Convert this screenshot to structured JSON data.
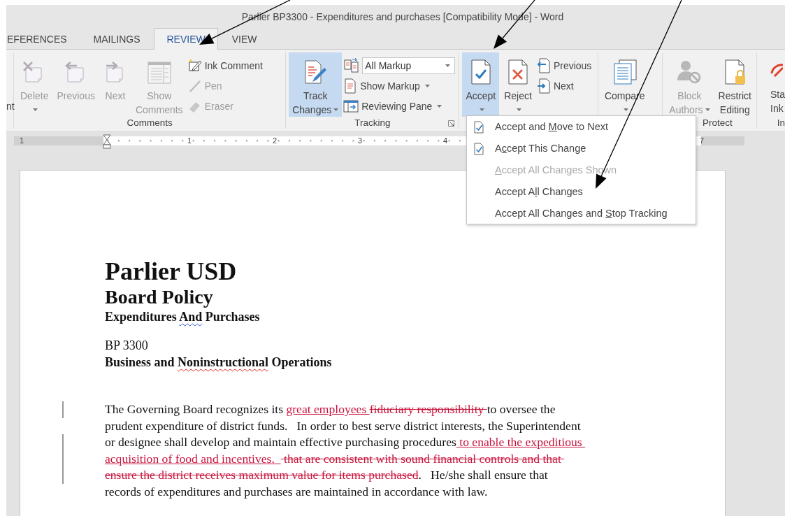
{
  "window": {
    "title": "Parlier BP3300 - Expenditures and purchases [Compatibility Mode] - Word"
  },
  "tabs": [
    {
      "label": "EFERENCES",
      "selected": false
    },
    {
      "label": "MAILINGS",
      "selected": false
    },
    {
      "label": "REVIEW",
      "selected": true
    },
    {
      "label": "VIEW",
      "selected": false
    }
  ],
  "ribbon": {
    "groups": [
      {
        "buttons": [
          {
            "kind": "fragment",
            "lines": [
              "nt"
            ],
            "disabled": false,
            "highlighted": false,
            "dropdown": false
          }
        ]
      },
      {
        "label": "Comments",
        "buttons": [
          {
            "kind": "large",
            "lines": [
              "Delete"
            ],
            "disabled": true,
            "highlighted": false,
            "dropdown": true
          },
          {
            "kind": "large",
            "lines": [
              "Previous"
            ],
            "disabled": true,
            "highlighted": false,
            "dropdown": false
          },
          {
            "kind": "large",
            "lines": [
              "Next"
            ],
            "disabled": true,
            "highlighted": false,
            "dropdown": false
          },
          {
            "kind": "large",
            "lines": [
              "Show",
              "Comments"
            ],
            "disabled": true,
            "highlighted": false,
            "dropdown": false
          },
          {
            "kind": "small",
            "lines": [
              "Ink Comment"
            ],
            "disabled": false,
            "highlighted": false,
            "dropdown": false
          },
          {
            "kind": "small",
            "lines": [
              "Pen"
            ],
            "disabled": true,
            "highlighted": false,
            "dropdown": false
          },
          {
            "kind": "small",
            "lines": [
              "Eraser"
            ],
            "disabled": true,
            "highlighted": false,
            "dropdown": false
          }
        ]
      },
      {
        "label": "Tracking",
        "launcher": true,
        "buttons": [
          {
            "kind": "large",
            "lines": [
              "Track",
              "Changes"
            ],
            "disabled": false,
            "highlighted": true,
            "dropdown": true
          },
          {
            "kind": "combo",
            "lines": [
              "All Markup"
            ],
            "disabled": false,
            "highlighted": false,
            "dropdown": true
          },
          {
            "kind": "small",
            "lines": [
              "Show Markup"
            ],
            "disabled": false,
            "highlighted": false,
            "dropdown": true
          },
          {
            "kind": "small",
            "lines": [
              "Reviewing Pane"
            ],
            "disabled": false,
            "highlighted": false,
            "dropdown": true
          }
        ]
      },
      {
        "buttons": [
          {
            "kind": "large",
            "lines": [
              "Accept"
            ],
            "disabled": false,
            "highlighted": true,
            "dropdown": true
          },
          {
            "kind": "large",
            "lines": [
              "Reject"
            ],
            "disabled": false,
            "highlighted": false,
            "dropdown": true
          },
          {
            "kind": "small",
            "lines": [
              "Previous"
            ],
            "disabled": false,
            "highlighted": false,
            "dropdown": false
          },
          {
            "kind": "small",
            "lines": [
              "Next"
            ],
            "disabled": false,
            "highlighted": false,
            "dropdown": false
          }
        ]
      },
      {
        "buttons": [
          {
            "kind": "large",
            "lines": [
              "Compare"
            ],
            "disabled": false,
            "highlighted": false,
            "dropdown": true
          }
        ]
      },
      {
        "label": "Protect",
        "buttons": [
          {
            "kind": "large",
            "lines": [
              "Block",
              "Authors"
            ],
            "disabled": true,
            "highlighted": false,
            "dropdown": true
          },
          {
            "kind": "large",
            "lines": [
              "Restrict",
              "Editing"
            ],
            "disabled": false,
            "highlighted": false,
            "dropdown": false
          }
        ]
      },
      {
        "label": "In",
        "buttons": [
          {
            "kind": "large",
            "lines": [
              "Sta",
              "Ink"
            ],
            "disabled": false,
            "highlighted": false,
            "dropdown": false
          }
        ]
      }
    ]
  },
  "ruler": {
    "numbers": [
      "1",
      "1",
      "2",
      "3",
      "4",
      "7"
    ]
  },
  "menu": {
    "items": [
      {
        "kind": "icon",
        "label": [
          {
            "text": "Accept and ",
            "access_key": false
          },
          {
            "text": "M",
            "access_key": true
          },
          {
            "text": "ove to Next",
            "access_key": false
          }
        ],
        "disabled": false
      },
      {
        "kind": "icon",
        "label": [
          {
            "text": "A",
            "access_key": false
          },
          {
            "text": "c",
            "access_key": true
          },
          {
            "text": "cept This Change",
            "access_key": false
          }
        ],
        "disabled": false
      },
      {
        "kind": "text",
        "label": [
          {
            "text": "A",
            "access_key": true
          },
          {
            "text": "ccept All Changes Shown",
            "access_key": false
          }
        ],
        "disabled": true
      },
      {
        "kind": "text",
        "label": [
          {
            "text": "Accept A",
            "access_key": false
          },
          {
            "text": "l",
            "access_key": true
          },
          {
            "text": "l Changes",
            "access_key": false
          }
        ],
        "disabled": false
      },
      {
        "kind": "text",
        "label": [
          {
            "text": "Accept All Changes and ",
            "access_key": false
          },
          {
            "text": "S",
            "access_key": true
          },
          {
            "text": "top Tracking",
            "access_key": false
          }
        ],
        "disabled": false
      }
    ]
  },
  "document": {
    "title": "Parlier USD",
    "subtitle": "Board Policy",
    "heading": [
      {
        "kind": "normal",
        "text": "Expenditures "
      },
      {
        "kind": "grammar",
        "text": "And"
      },
      {
        "kind": "normal",
        "text": " Purchases"
      }
    ],
    "policy_number": "BP 3300",
    "section": [
      {
        "kind": "normal",
        "text": "Business and "
      },
      {
        "kind": "spelling",
        "text": "Noninstructional"
      },
      {
        "kind": "normal",
        "text": " Operations"
      }
    ],
    "paragraph": [
      {
        "changed": true,
        "segments": [
          {
            "kind": "normal",
            "text": "The Governing Board recognizes its "
          },
          {
            "kind": "inserted",
            "text": "great employees "
          },
          {
            "kind": "deleted",
            "text": "fiduciary responsibility "
          },
          {
            "kind": "normal",
            "text": "to oversee the"
          }
        ]
      },
      {
        "changed": false,
        "segments": [
          {
            "kind": "normal",
            "text": "prudent expenditure of district funds.   In order to best serve district interests, the Superintendent"
          }
        ]
      },
      {
        "changed": true,
        "segments": [
          {
            "kind": "normal",
            "text": "or designee shall develop and maintain effective purchasing procedures"
          },
          {
            "kind": "inserted",
            "text": " to enable the expeditious "
          }
        ]
      },
      {
        "changed": true,
        "segments": [
          {
            "kind": "inserted",
            "text": "acquisition of food and incentives.  "
          },
          {
            "kind": "deleted",
            "text": " that are consistent with sound financial controls and that "
          }
        ]
      },
      {
        "changed": true,
        "segments": [
          {
            "kind": "deleted",
            "text": "ensure the district receives maximum value for items purchased"
          },
          {
            "kind": "normal",
            "text": ".   He/she shall ensure that"
          }
        ]
      },
      {
        "changed": false,
        "segments": [
          {
            "kind": "normal",
            "text": "records of expenditures and purchases are maintained in accordance with law."
          }
        ]
      }
    ]
  }
}
